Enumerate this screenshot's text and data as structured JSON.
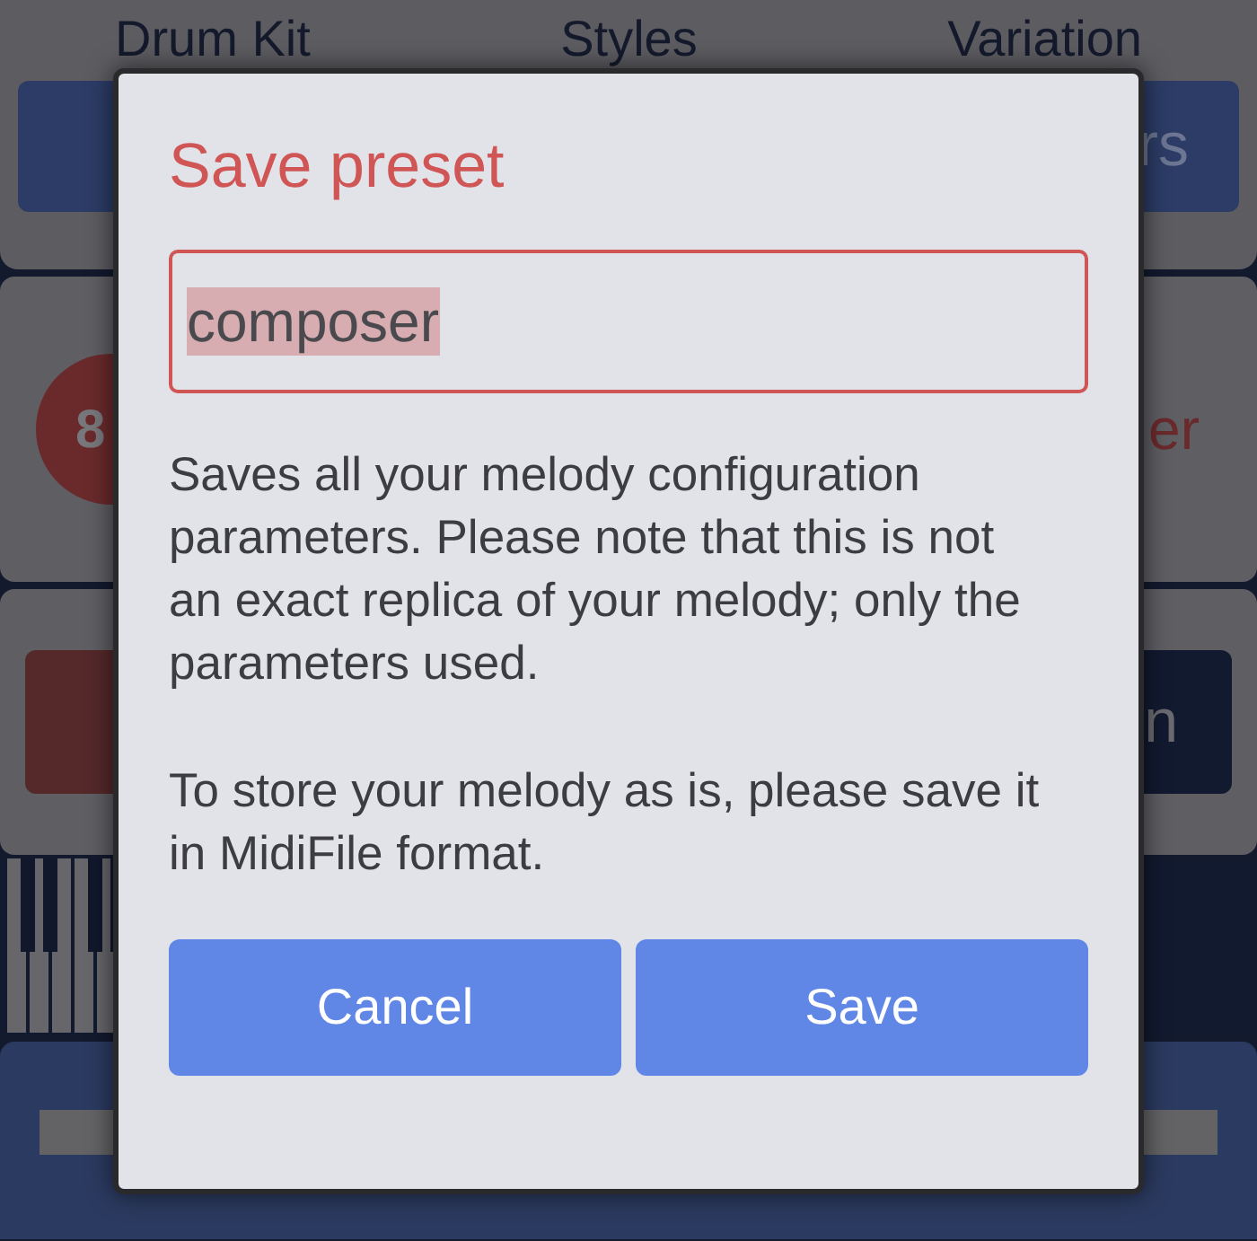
{
  "background": {
    "header_labels": [
      "Drum Kit",
      "Styles",
      "Variation"
    ],
    "top_button_fragment": "rs",
    "dial_fragment": "8",
    "label_fragment": "er",
    "dark_button_fragment": "n"
  },
  "dialog": {
    "title": "Save preset",
    "name_field": {
      "value": "composer",
      "selected": true
    },
    "paragraphs": [
      "Saves all your melody configuration parameters. Please note that this is not an exact replica of your melody; only the parameters used.",
      "To store your melody as is, please save it in MidiFile format."
    ],
    "buttons": [
      {
        "label": "Cancel"
      },
      {
        "label": "Save"
      }
    ]
  }
}
